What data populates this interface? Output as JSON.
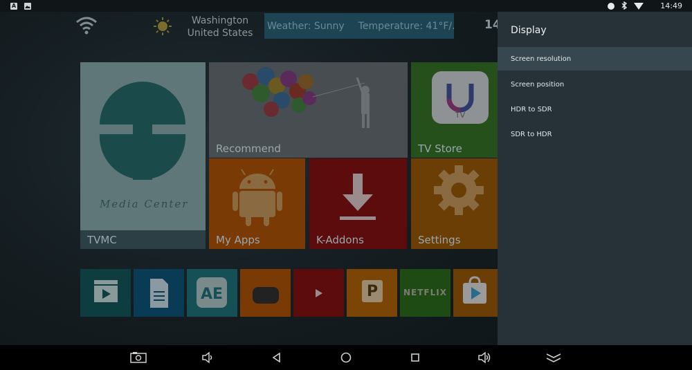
{
  "status_bar": {
    "left_icons": [
      "a-icon",
      "image-icon"
    ],
    "right_icons": [
      "record-dot-icon",
      "bluetooth-icon",
      "wifi-icon"
    ],
    "time": "14:49"
  },
  "launcher": {
    "location_city": "Washington",
    "location_country": "United States",
    "weather": "Weather: Sunny",
    "temperature": "Temperature: 41°F/...",
    "clock_partial": "14",
    "tiles": {
      "tvmc": {
        "label": "TVMC",
        "caption": "Media Center"
      },
      "recommend": {
        "label": "Recommend"
      },
      "tv_store": {
        "label": "TV Store",
        "badge": "TV"
      },
      "my_apps": {
        "label": "My Apps"
      },
      "k_addons": {
        "label": "K-Addons"
      },
      "settings": {
        "label": "Settings"
      }
    },
    "app_row": [
      {
        "name": "video-player",
        "icon": "clapper-icon",
        "color": "#0d3d3f"
      },
      {
        "name": "documents",
        "icon": "document-icon",
        "color": "#0a3b55"
      },
      {
        "name": "app-store",
        "icon": "ae-icon",
        "color": "#145056"
      },
      {
        "name": "tv-app",
        "icon": "tv-icon",
        "color": "#7a3a05"
      },
      {
        "name": "youtube",
        "icon": "play-icon",
        "color": "#5c0c0c"
      },
      {
        "name": "p-app",
        "text": "P",
        "icon": "p-icon",
        "color": "#7a4505"
      },
      {
        "name": "netflix",
        "text": "NETFLIX",
        "icon": "netflix-icon",
        "color": "#1e4a14"
      },
      {
        "name": "play-store",
        "icon": "play-store-icon",
        "color": "#6b3e05"
      }
    ]
  },
  "panel": {
    "title": "Display",
    "items": [
      {
        "label": "Screen resolution",
        "selected": true
      },
      {
        "label": "Screen position",
        "selected": false
      },
      {
        "label": "HDR to SDR",
        "selected": false
      },
      {
        "label": "SDR to HDR",
        "selected": false
      }
    ]
  },
  "nav_bar": {
    "buttons": [
      "screenshot-icon",
      "volume-down-icon",
      "back-icon",
      "home-icon",
      "recents-icon",
      "volume-up-icon",
      "collapse-icon"
    ]
  }
}
